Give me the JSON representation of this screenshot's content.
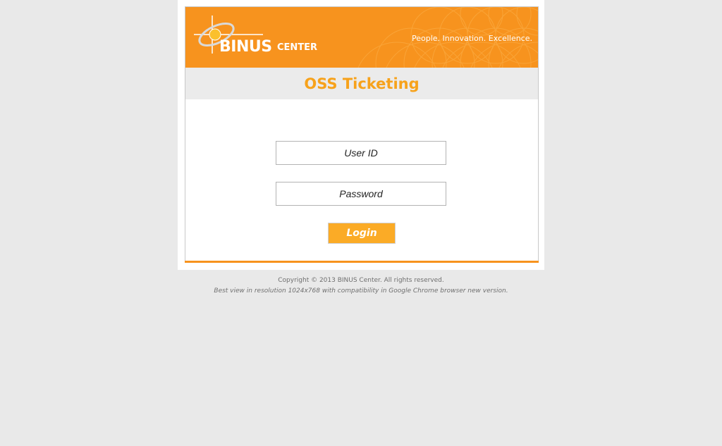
{
  "header": {
    "brand_main": "BINUS",
    "brand_sub": "CENTER",
    "tagline": "People. Innovation. Excellence."
  },
  "page": {
    "title": "OSS Ticketing"
  },
  "login_form": {
    "user_id_placeholder": "User ID",
    "password_placeholder": "Password",
    "login_label": "Login"
  },
  "footer": {
    "copyright": "Copyright © 2013 BINUS Center. All rights reserved.",
    "note": "Best view in resolution 1024x768 with compatibility in Google Chrome browser new version."
  },
  "colors": {
    "brand_orange": "#f7931e",
    "title_orange": "#f7a21b",
    "button_orange": "#fbab26",
    "page_bg": "#e9e9e9"
  },
  "icons": [
    "binus-logo-icon"
  ]
}
